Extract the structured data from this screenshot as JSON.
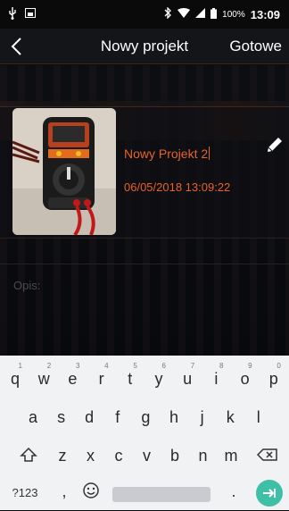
{
  "status_bar": {
    "time": "13:09",
    "battery": "100%"
  },
  "header": {
    "title": "Nowy projekt",
    "done_label": "Gotowe"
  },
  "project": {
    "name": "Nowy Projekt 2",
    "date": "06/05/2018 13:09:22"
  },
  "description": {
    "placeholder": "Opis:"
  },
  "keyboard": {
    "row1": [
      {
        "key": "q",
        "hint": "1"
      },
      {
        "key": "w",
        "hint": "2"
      },
      {
        "key": "e",
        "hint": "3"
      },
      {
        "key": "r",
        "hint": "4"
      },
      {
        "key": "t",
        "hint": "5"
      },
      {
        "key": "y",
        "hint": "6"
      },
      {
        "key": "u",
        "hint": "7"
      },
      {
        "key": "i",
        "hint": "8"
      },
      {
        "key": "o",
        "hint": "9"
      },
      {
        "key": "p",
        "hint": "0"
      }
    ],
    "row2": [
      "a",
      "s",
      "d",
      "f",
      "g",
      "h",
      "j",
      "k",
      "l"
    ],
    "row3": [
      "z",
      "x",
      "c",
      "v",
      "b",
      "n",
      "m"
    ],
    "symbols_label": "?123",
    "comma": ",",
    "period": "."
  },
  "colors": {
    "accent": "#e8622b",
    "enter": "#3fbfa6"
  }
}
